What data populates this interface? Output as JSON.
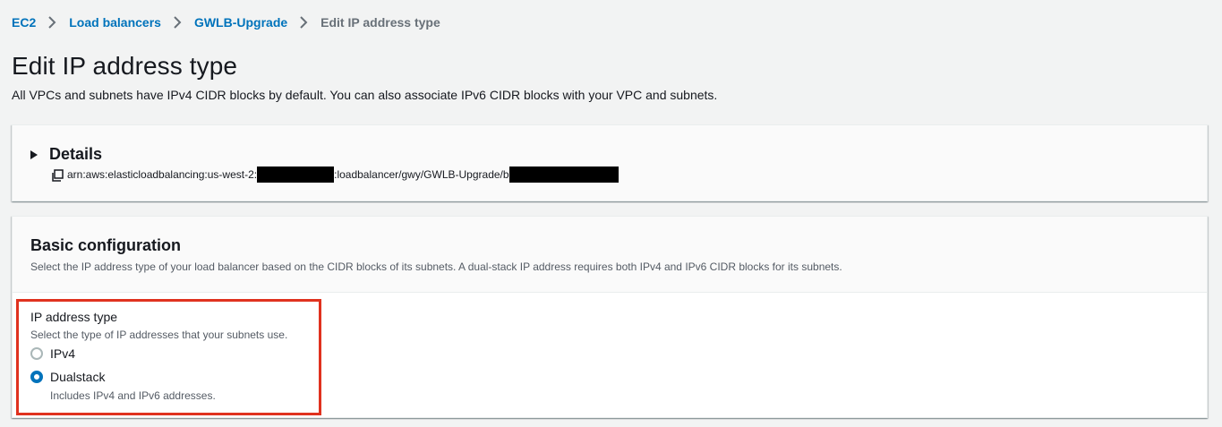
{
  "breadcrumb": {
    "items": [
      "EC2",
      "Load balancers",
      "GWLB-Upgrade"
    ],
    "current": "Edit IP address type"
  },
  "page": {
    "title": "Edit IP address type",
    "description": "All VPCs and subnets have IPv4 CIDR blocks by default. You can also associate IPv6 CIDR blocks with your VPC and subnets."
  },
  "details": {
    "title": "Details",
    "arn_part1": "arn:aws:elasticloadbalancing:us-west-2:",
    "arn_part2": ":loadbalancer/gwy/GWLB-Upgrade/",
    "arn_part2_tail": "b"
  },
  "basic_config": {
    "title": "Basic configuration",
    "description": "Select the IP address type of your load balancer based on the CIDR blocks of its subnets. A dual-stack IP address requires both IPv4 and IPv6 CIDR blocks for its subnets."
  },
  "ip_address_type": {
    "label": "IP address type",
    "description": "Select the type of IP addresses that your subnets use.",
    "options": [
      {
        "label": "IPv4",
        "checked": false,
        "description": ""
      },
      {
        "label": "Dualstack",
        "checked": true,
        "description": "Includes IPv4 and IPv6 addresses."
      }
    ]
  },
  "colors": {
    "link": "#0073bb",
    "highlight_border": "#e0321f",
    "radio_checked": "#0073bb"
  },
  "icons": {
    "breadcrumb_separator": "chevron-right-icon",
    "details_toggle": "caret-right-icon",
    "copy": "copy-icon"
  }
}
